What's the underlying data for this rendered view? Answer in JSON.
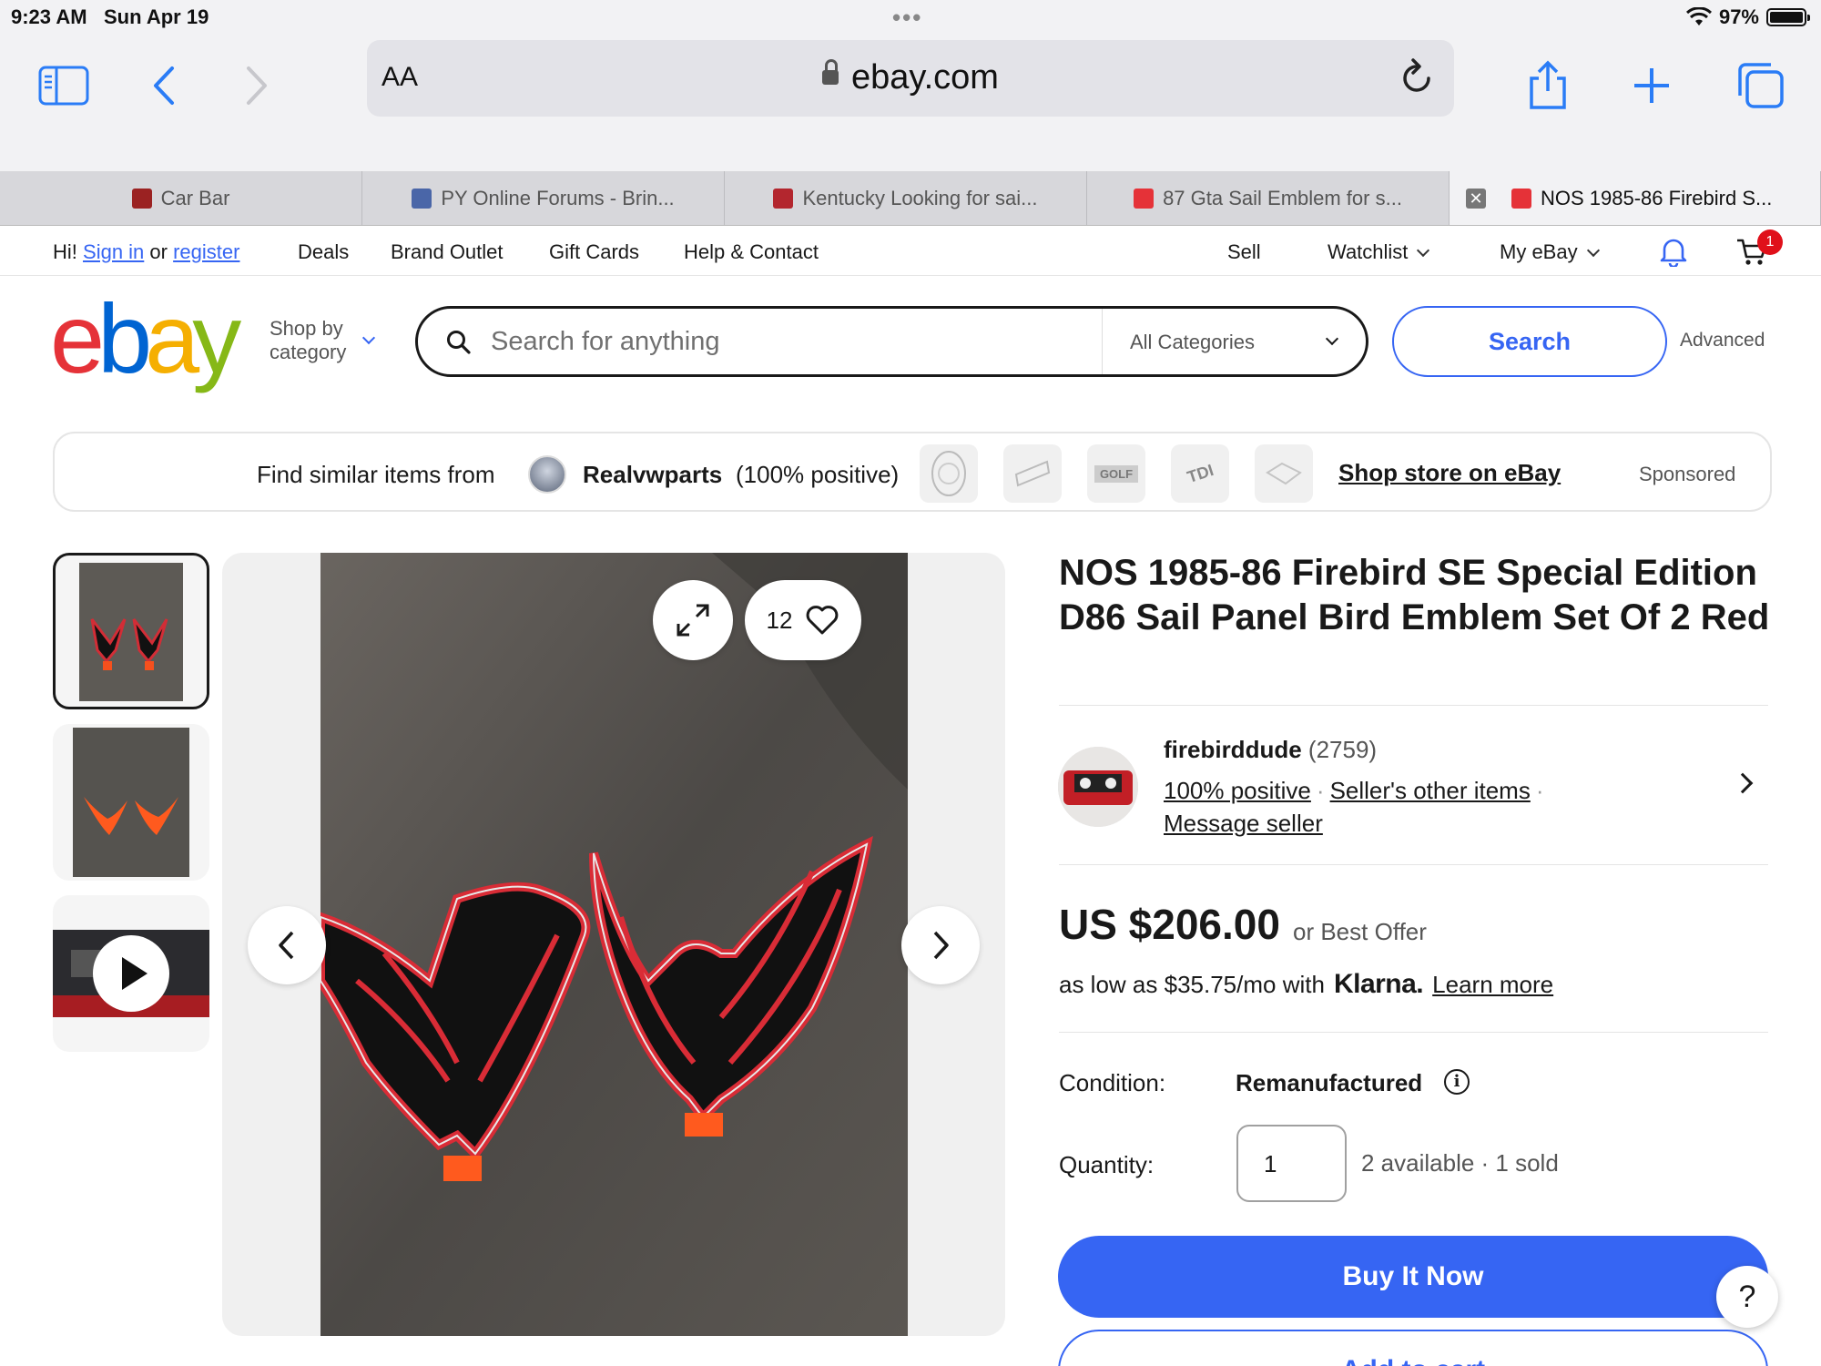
{
  "status_bar": {
    "time": "9:23 AM",
    "date": "Sun Apr 19",
    "dots": "•••",
    "battery": "97%"
  },
  "browser": {
    "aa": "AA",
    "url": "ebay.com"
  },
  "tabs": [
    {
      "label": "Car Bar",
      "fav_color": "#9b2222"
    },
    {
      "label": "PY Online Forums - Brin...",
      "fav_color": "#4a66a8"
    },
    {
      "label": "Kentucky Looking for sai...",
      "fav_color": "#b3262e"
    },
    {
      "label": "87 Gta Sail Emblem for s...",
      "fav_color": "#e53238"
    },
    {
      "label": "NOS 1985-86 Firebird S...",
      "fav_color": "#e53238",
      "active": true
    }
  ],
  "topnav": {
    "hi": "Hi!",
    "sign_in": "Sign in",
    "or": "or",
    "register": "register",
    "deals": "Deals",
    "brand_outlet": "Brand Outlet",
    "gift_cards": "Gift Cards",
    "help": "Help & Contact",
    "sell": "Sell",
    "watchlist": "Watchlist",
    "my_ebay": "My eBay",
    "cart_count": "1"
  },
  "header": {
    "shop_by_line1": "Shop by",
    "shop_by_line2": "category",
    "search_placeholder": "Search for anything",
    "category": "All Categories",
    "search_button": "Search",
    "advanced": "Advanced"
  },
  "store_banner": {
    "find_similar": "Find similar items from",
    "seller": "Realvwparts",
    "feedback": "(100% positive)",
    "thumb_texts": [
      "GOLF",
      "TDI"
    ],
    "shop_store": "Shop store on eBay",
    "sponsored": "Sponsored"
  },
  "gallery": {
    "watch_count": "12"
  },
  "listing": {
    "title": "NOS 1985-86 Firebird SE Special Edition D86 Sail Panel Bird Emblem Set Of 2 Red",
    "seller_name": "firebirddude",
    "seller_feedback": "(2759)",
    "positive": "100% positive",
    "other_items": "Seller's other items",
    "message": "Message seller",
    "price": "US $206.00",
    "best_offer": "or Best Offer",
    "klarna_prefix": "as low as $35.75/mo with",
    "klarna_brand": "Klarna.",
    "learn_more": "Learn more",
    "condition_label": "Condition:",
    "condition_value": "Remanufactured",
    "quantity_label": "Quantity:",
    "quantity_value": "1",
    "availability": "2 available · 1 sold",
    "buy_now": "Buy It Now",
    "add_to_cart": "Add to cart",
    "help": "?"
  }
}
